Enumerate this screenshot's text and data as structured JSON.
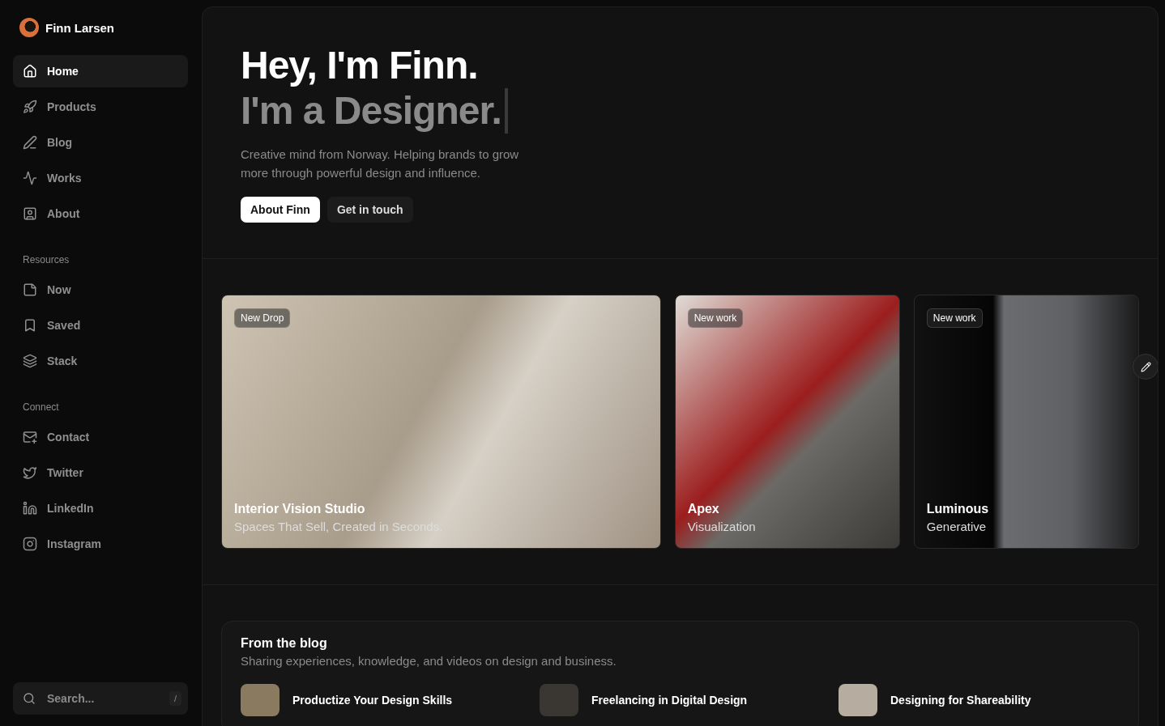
{
  "profile": {
    "name": "Finn Larsen"
  },
  "nav": [
    {
      "label": "Home",
      "selected": true
    },
    {
      "label": "Products",
      "selected": false
    },
    {
      "label": "Blog",
      "selected": false
    },
    {
      "label": "Works",
      "selected": false
    },
    {
      "label": "About",
      "selected": false
    }
  ],
  "sections": [
    {
      "title": "Resources",
      "items": [
        {
          "label": "Now",
          "selected": false
        },
        {
          "label": "Saved",
          "selected": false
        },
        {
          "label": "Stack",
          "selected": false
        }
      ]
    },
    {
      "title": "Connect",
      "items": [
        {
          "label": "Contact",
          "selected": false
        },
        {
          "label": "Twitter",
          "selected": false
        },
        {
          "label": "LinkedIn",
          "selected": false
        },
        {
          "label": "Instagram",
          "selected": false
        }
      ]
    }
  ],
  "search": {
    "placeholder": "Search...",
    "shortcut": "/"
  },
  "hero": {
    "title": "Hey, I'm Finn.",
    "subtitle": "I'm a Designer.",
    "description": "Creative mind from Norway. Helping brands to grow more through powerful design and influence.",
    "buttons": [
      {
        "label": "About Finn",
        "kind": "primary"
      },
      {
        "label": "Get in touch",
        "kind": "secondary"
      }
    ]
  },
  "works": [
    {
      "badge": "New Drop",
      "title": "Interior Vision Studio",
      "subtitle": "Spaces That Sell, Created in Seconds."
    },
    {
      "badge": "New work",
      "title": "Apex",
      "subtitle": "Visualization"
    },
    {
      "badge": "New work",
      "title": "Luminous",
      "subtitle": "Generative"
    }
  ],
  "blog": {
    "title": "From the blog",
    "description": "Sharing experiences, knowledge, and videos on design and business.",
    "posts": [
      {
        "title": "Productize Your Design Skills"
      },
      {
        "title": "Freelancing in Digital Design"
      },
      {
        "title": "Designing for Shareability"
      }
    ]
  }
}
